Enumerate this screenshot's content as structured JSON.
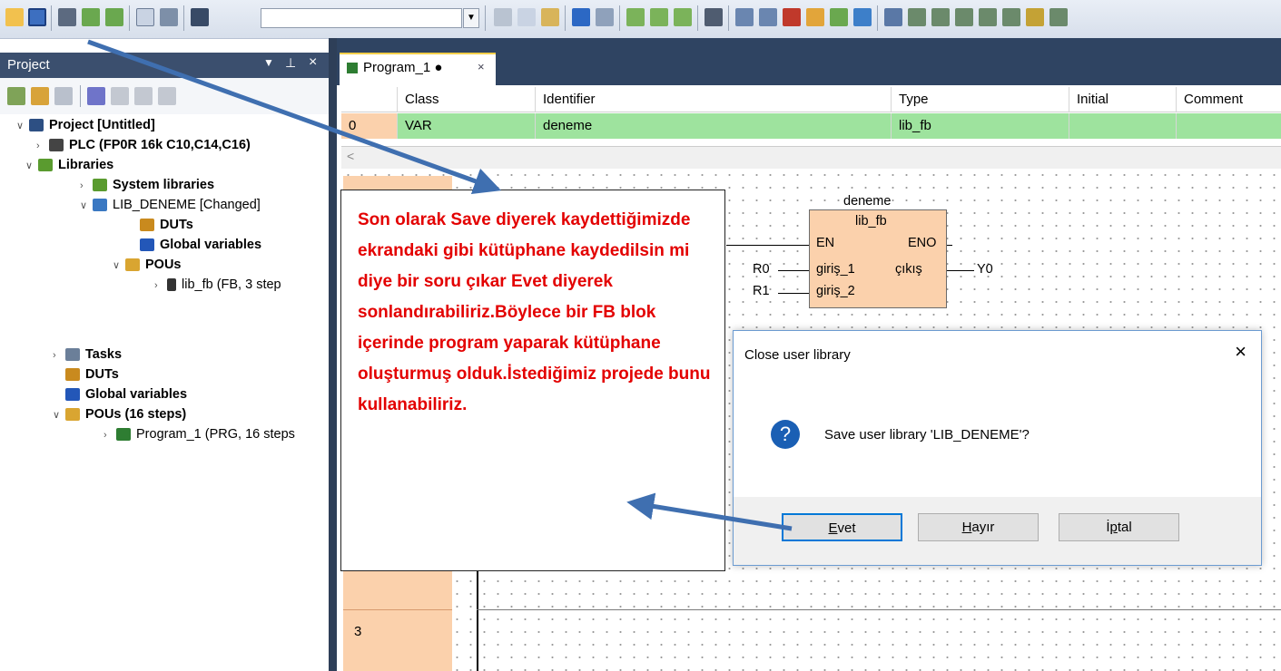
{
  "toolbar": {
    "search_value": ""
  },
  "project_panel": {
    "title": "Project",
    "pin": "⬇ ⬝",
    "tree": [
      {
        "label": "Project [Untitled]",
        "bold": true,
        "icon": "project-icon",
        "color": "#2d4f83"
      },
      {
        "label": "PLC (FP0R 16k C10,C14,C16)",
        "bold": true,
        "icon": "plc-icon",
        "color": "#444"
      },
      {
        "label": "Libraries",
        "bold": true,
        "icon": "libraries-icon",
        "color": "#5a9b2f"
      },
      {
        "label": "System libraries",
        "bold": true,
        "icon": "system-libraries-icon",
        "color": "#5a9b2f"
      },
      {
        "label": "LIB_DENEME [Changed]",
        "bold": false,
        "icon": "library-book-icon",
        "color": "#3a78c2"
      },
      {
        "label": "DUTs",
        "bold": true,
        "icon": "duts-icon",
        "color": "#c98a1e"
      },
      {
        "label": "Global variables",
        "bold": true,
        "icon": "global-variables-icon",
        "color": "#2357b8"
      },
      {
        "label": "POUs",
        "bold": true,
        "icon": "pous-icon",
        "color": "#d9a531"
      },
      {
        "label": "lib_fb (FB, 3 step",
        "bold": false,
        "icon": "function-block-icon",
        "color": "#333"
      },
      {
        "label": "Tasks",
        "bold": true,
        "icon": "tasks-icon",
        "color": "#6b7f99"
      },
      {
        "label": "DUTs",
        "bold": true,
        "icon": "duts-icon",
        "color": "#c98a1e"
      },
      {
        "label": "Global variables",
        "bold": true,
        "icon": "global-variables-icon",
        "color": "#2357b8"
      },
      {
        "label": "POUs (16 steps)",
        "bold": true,
        "icon": "pous-icon",
        "color": "#d9a531"
      },
      {
        "label": "Program_1 (PRG, 16 steps",
        "bold": false,
        "icon": "program-icon",
        "color": "#2e7d32"
      }
    ]
  },
  "editor": {
    "tab_label": "Program_1 ●",
    "tab_close": "×",
    "table": {
      "columns": [
        "Class",
        "Identifier",
        "Type",
        "Initial",
        "Comment"
      ],
      "row": {
        "index": "0",
        "class": "VAR",
        "identifier": "deneme",
        "type": "lib_fb",
        "initial": "",
        "comment": ""
      }
    },
    "scroll_left": "<",
    "rung_number": "3",
    "fb": {
      "instance": "deneme",
      "type": "lib_fb",
      "en": "EN",
      "eno": "ENO",
      "in1": "giriş_1",
      "in2": "giriş_2",
      "out1": "çıkış",
      "contact1": "R0",
      "contact2": "R1",
      "coil": "Y0"
    }
  },
  "dialog": {
    "title": "Close user library",
    "close": "×",
    "message": "Save user library 'LIB_DENEME'?",
    "icon": "?",
    "buttons": [
      "Evet",
      "Hayır",
      "İptal"
    ]
  },
  "note": "Son olarak Save diyerek kaydettiğimizde ekrandaki gibi kütüphane kaydedilsin mi diye bir soru çıkar Evet diyerek sonlandırabiliriz.Böylece bir FB blok içerinde program  yaparak kütüphane oluşturmuş olduk.İstediğimiz projede bunu kullanabiliriz.",
  "colors": {
    "accent": "#3f6fb0",
    "note_text": "#e30000",
    "var_row": "#9ee39e",
    "rung": "#fbd1ac"
  }
}
